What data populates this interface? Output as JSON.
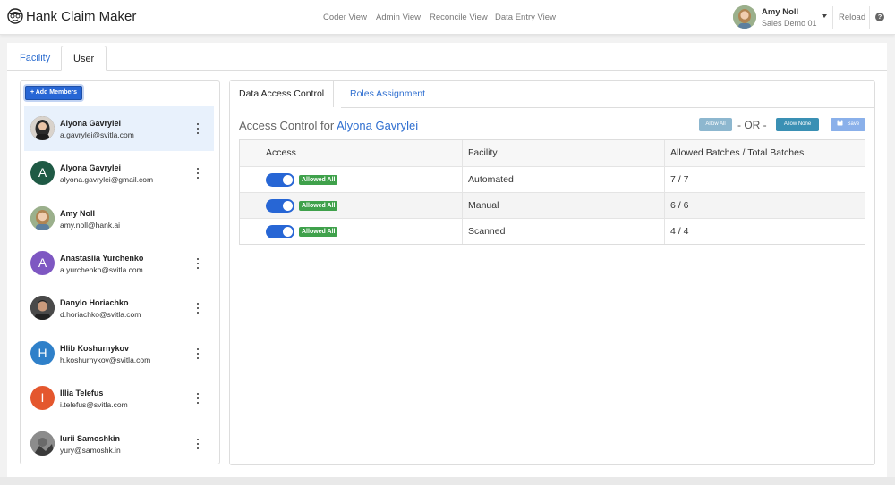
{
  "app": {
    "title": "Hank Claim Maker"
  },
  "nav": [
    "Coder View",
    "Admin View",
    "Reconcile View",
    "Data Entry View"
  ],
  "current_user": {
    "name": "Amy Noll",
    "org": "Sales Demo 01"
  },
  "header_actions": {
    "reload": "Reload",
    "help_icon": "?"
  },
  "main_tabs": [
    {
      "label": "Facility",
      "active": false
    },
    {
      "label": "User",
      "active": true
    }
  ],
  "members": {
    "add_button": "+ Add Members",
    "list": [
      {
        "name": "Alyona Gavrylei",
        "email": "a.gavrylei@svitla.com",
        "initial": "",
        "color": "#3a3a3a",
        "photo": true,
        "selected": true
      },
      {
        "name": "Alyona Gavrylei",
        "email": "alyona.gavrylei@gmail.com",
        "initial": "A",
        "color": "#1f5a45",
        "photo": false,
        "selected": false
      },
      {
        "name": "Amy Noll",
        "email": "amy.noll@hank.ai",
        "initial": "",
        "color": "#8aa07a",
        "photo": true,
        "selected": false
      },
      {
        "name": "Anastasiia Yurchenko",
        "email": "a.yurchenko@svitla.com",
        "initial": "A",
        "color": "#7e57c2",
        "photo": false,
        "selected": false
      },
      {
        "name": "Danylo Horiachko",
        "email": "d.horiachko@svitla.com",
        "initial": "",
        "color": "#3b3b3b",
        "photo": true,
        "selected": false
      },
      {
        "name": "Hlib Koshurnykov",
        "email": "h.koshurnykov@svitla.com",
        "initial": "H",
        "color": "#2f80c9",
        "photo": false,
        "selected": false
      },
      {
        "name": "Illia Telefus",
        "email": "i.telefus@svitla.com",
        "initial": "I",
        "color": "#e4572e",
        "photo": false,
        "selected": false
      },
      {
        "name": "Iurii Samoshkin",
        "email": "yury@samoshk.in",
        "initial": "",
        "color": "#555555",
        "photo": true,
        "selected": false
      }
    ]
  },
  "sub_tabs": [
    {
      "label": "Data Access Control",
      "active": true
    },
    {
      "label": "Roles Assignment",
      "active": false
    }
  ],
  "access_control": {
    "title_prefix": "Access Control for",
    "user_name": "Alyona Gavrylei",
    "allow_all": "Allow All",
    "or": "- OR -",
    "allow_none": "Allow None",
    "save": "Save",
    "columns": [
      "Access",
      "Facility",
      "Allowed Batches / Total Batches"
    ],
    "rows": [
      {
        "badge": "Allowed All",
        "facility": "Automated",
        "batches": "7 / 7",
        "enabled": true
      },
      {
        "badge": "Allowed All",
        "facility": "Manual",
        "batches": "6 / 6",
        "enabled": true
      },
      {
        "badge": "Allowed All",
        "facility": "Scanned",
        "batches": "4 / 4",
        "enabled": true
      }
    ]
  },
  "colors": {
    "accent": "#2766d5",
    "link": "#2f6fd0",
    "success": "#3fa14b"
  }
}
